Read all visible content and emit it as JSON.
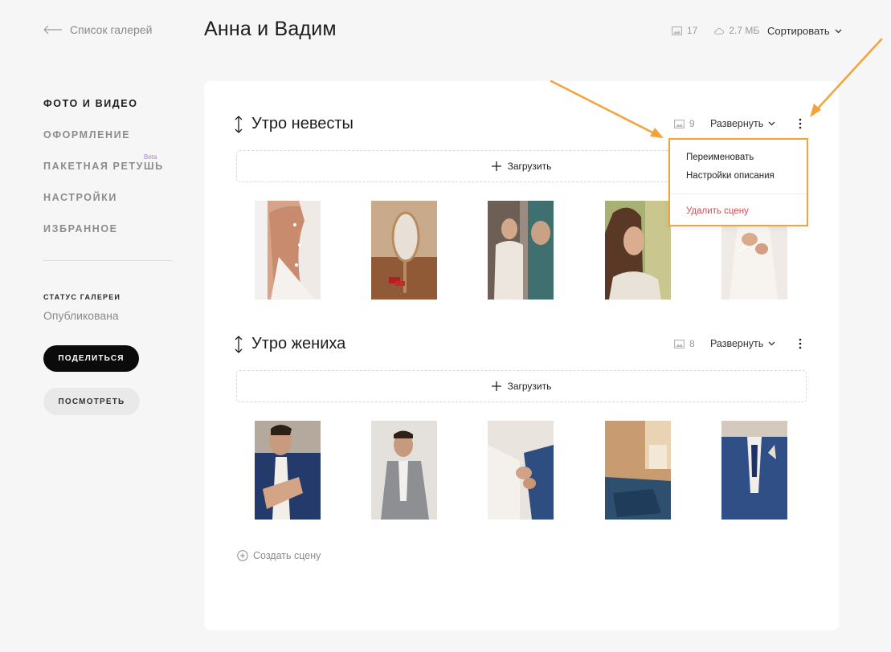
{
  "header": {
    "back_label": "Список галерей",
    "gallery_title": "Анна и Вадим",
    "photo_count": "17",
    "storage": "2.7 МБ",
    "sort_label": "Сортировать"
  },
  "sidebar": {
    "items": [
      {
        "label": "ФОТО И ВИДЕО",
        "active": true
      },
      {
        "label": "ОФОРМЛЕНИЕ",
        "active": false
      },
      {
        "label": "ПАКЕТНАЯ РЕТУШЬ",
        "active": false
      },
      {
        "label": "НАСТРОЙКИ",
        "active": false
      },
      {
        "label": "ИЗБРАННОЕ",
        "active": false
      }
    ],
    "beta_badge": "Beta",
    "status_label": "СТАТУС ГАЛЕРЕИ",
    "status_value": "Опубликована",
    "share_button": "ПОДЕЛИТЬСЯ",
    "view_button": "ПОСМОТРЕТЬ"
  },
  "scenes": [
    {
      "title": "Утро невесты",
      "count": "9",
      "expand_label": "Развернуть",
      "upload_label": "Загрузить"
    },
    {
      "title": "Утро жениха",
      "count": "8",
      "expand_label": "Развернуть",
      "upload_label": "Загрузить"
    }
  ],
  "create_scene_label": "Создать сцену",
  "menu": {
    "items": [
      {
        "label": "Переименовать"
      },
      {
        "label": "Настройки описания"
      },
      {
        "label": "Удалить сцену",
        "danger": true
      }
    ]
  },
  "colors": {
    "accent_orange": "#f3a33a",
    "danger": "#e2474f",
    "beta": "#b07fd4",
    "primary_button": "#0b0b0b"
  }
}
